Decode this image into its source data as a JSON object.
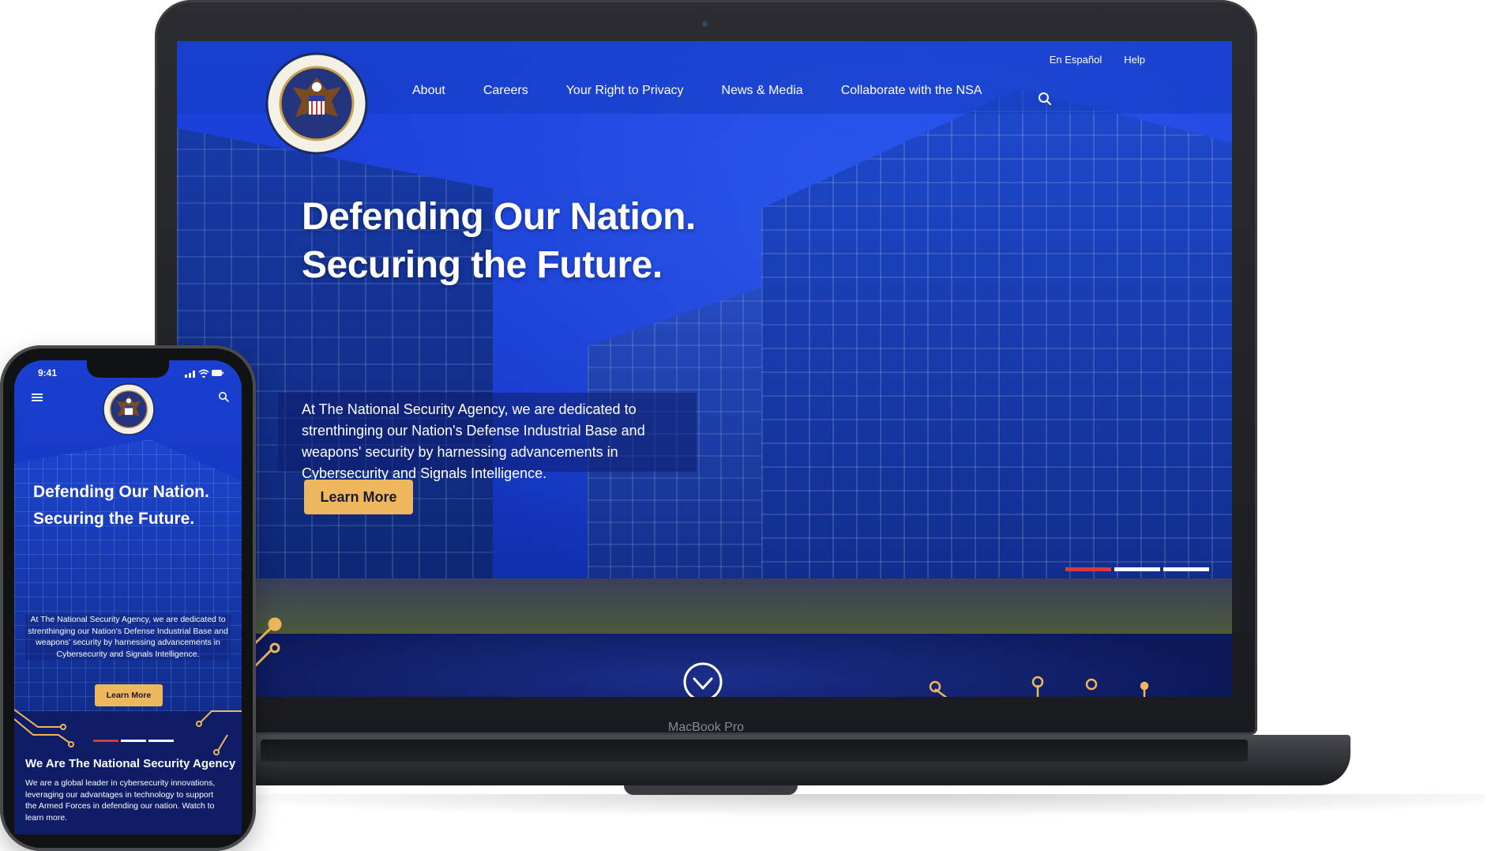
{
  "laptop": {
    "model_label": "MacBook Pro",
    "utility": {
      "espanol": "En Español",
      "help": "Help"
    },
    "nav": [
      "About",
      "Careers",
      "Your Right to Privacy",
      "News & Media",
      "Collaborate with the NSA"
    ],
    "hero": {
      "line1": "Defending Our Nation.",
      "line2": "Securing the Future.",
      "description": "At The National Security Agency, we are dedicated to strenthinging our Nation's Defense Industrial Base and weapons' security by harnessing advancements in Cybersecurity and Signals Intelligence.",
      "cta": "Learn More"
    },
    "icons": {
      "search": "search-icon",
      "scroll": "chevron-circle-down-icon",
      "seal": "nsa-seal-logo"
    }
  },
  "phone": {
    "time": "9:41",
    "hero": {
      "line1": "Defending Our Nation.",
      "line2": "Securing the Future.",
      "description": "At The National Security Agency, we are dedicated to strenthinging our Nation's Defense Industrial Base and weapons' security by harnessing advancements in Cybersecurity and Signals Intelligence.",
      "cta": "Learn More"
    },
    "section": {
      "title": "We Are The National Security Agency",
      "text": "We are a global leader in cybersecurity innovations, leveraging our advantages in technology to support the Armed Forces in defending our nation. Watch to learn more."
    }
  },
  "colors": {
    "brand_blue": "#1138d6",
    "navy": "#0c1a5a",
    "cta_gold": "#efb75d",
    "active_dot": "#d43c3c"
  }
}
